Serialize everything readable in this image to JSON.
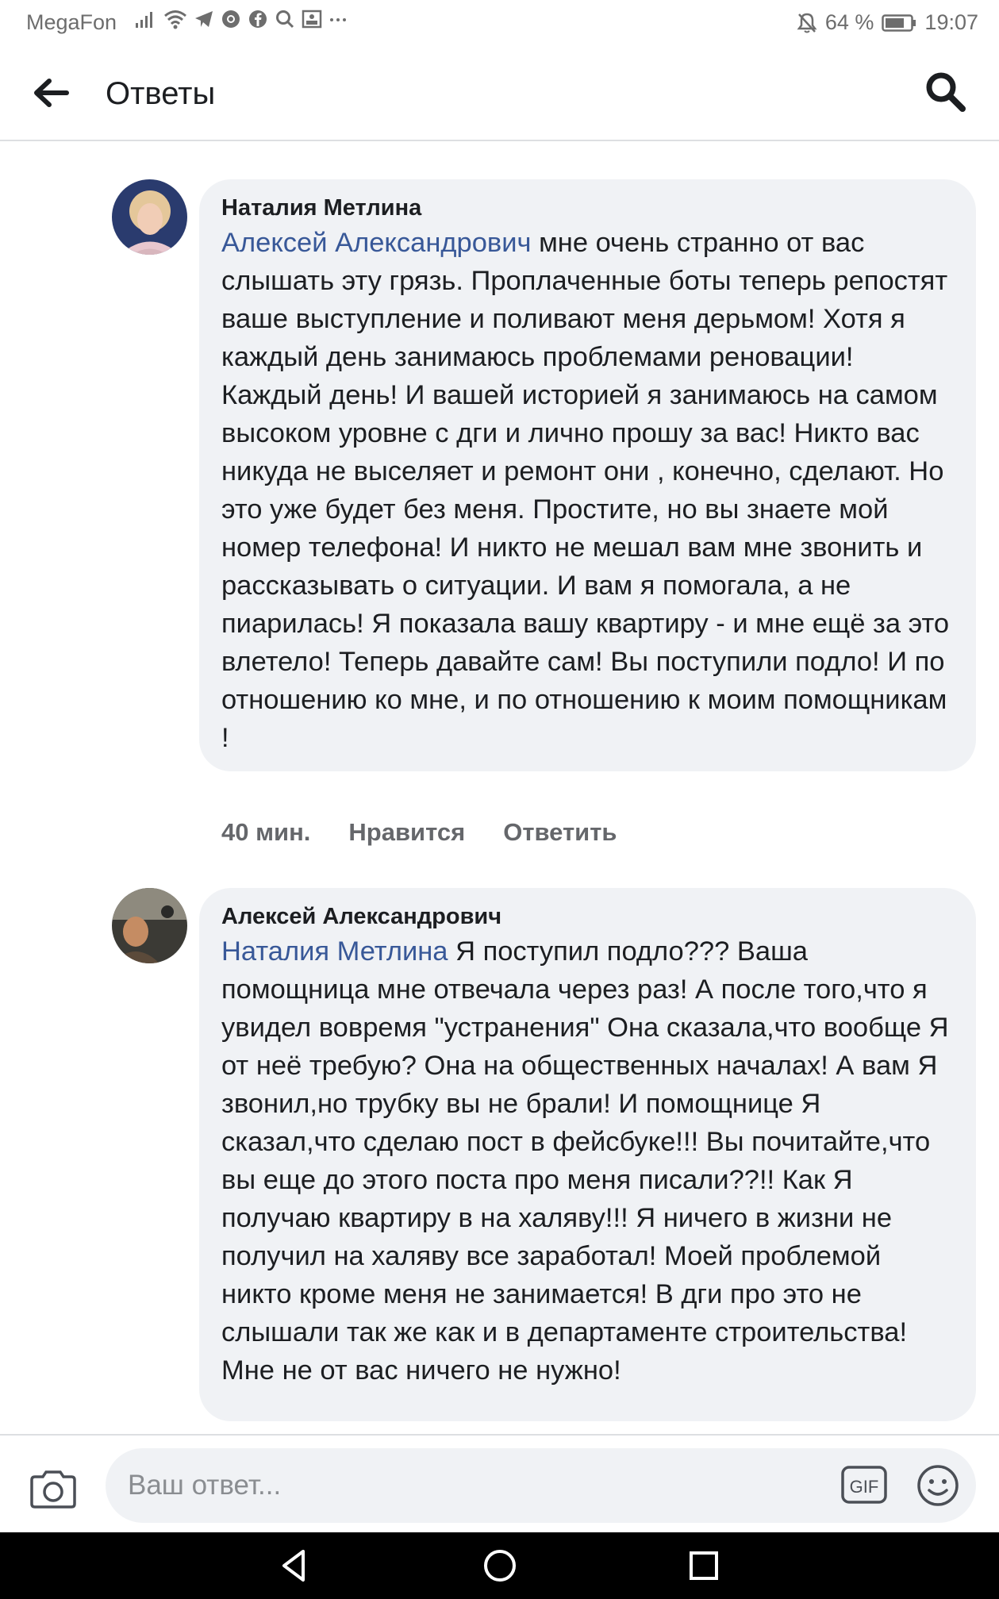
{
  "status_bar": {
    "carrier": "MegaFon",
    "battery": "64 %",
    "time": "19:07",
    "icons": [
      "signal-icon",
      "wifi-icon",
      "telegram-icon",
      "chrome-icon",
      "facebook-icon",
      "search-icon",
      "gallery-icon",
      "more-icon",
      "mute-icon",
      "battery-icon"
    ]
  },
  "header": {
    "title": "Ответы",
    "back_icon": "arrow-left-icon",
    "search_icon": "search-icon"
  },
  "comments": [
    {
      "author": "Наталия Метлина",
      "mention": "Алексей Александрович",
      "text": "мне очень странно от вас слышать эту грязь. Проплаченные боты теперь репостят ваше выступление и поливают меня дерьмом! Хотя я каждый день занимаюсь проблемами реновации! Каждый день! И вашей историей я занимаюсь на самом высоком уровне с дги и лично прошу за вас! Никто вас никуда не выселяет и ремонт они , конечно, сделают. Но это уже будет без меня. Простите, но вы знаете мой номер телефона! И никто не мешал вам мне звонить и рассказывать о ситуации. И вам я помогала, а не пиарилась! Я показала вашу квартиру - и мне ещё за это влетело! Теперь давайте сам! Вы поступили подло! И по отношению ко мне, и по отношению к моим помощникам !",
      "time": "40 мин.",
      "like_label": "Нравится",
      "reply_label": "Ответить"
    },
    {
      "author": "Алексей Александрович",
      "mention": "Наталия Метлина",
      "text": "Я поступил подло??? Ваша помощница мне отвечала через раз! А после того,что я увидел вовремя \"устранения\" Она сказала,что вообще Я от неё требую? Она на общественных началах! А вам Я звонил,но трубку вы не брали! И помощнице Я сказал,что сделаю пост в фейсбуке!!! Вы почитайте,что вы еще до этого поста про меня писали??!! Как Я получаю квартиру в на халяву!!! Я ничего в жизни не получил на халяву все заработал! Моей проблемой никто кроме меня не занимается! В дги про это не слышали так же как и в департаменте строительства!Мне не от вас ничего не нужно!"
    }
  ],
  "composer": {
    "placeholder": "Ваш ответ...",
    "gif_label": "GIF",
    "camera_icon": "camera-icon",
    "emoji_icon": "emoji-icon"
  },
  "nav": {
    "back_icon": "triangle-back-icon",
    "home_icon": "circle-home-icon",
    "recents_icon": "square-recents-icon"
  },
  "colors": {
    "mention": "#385898",
    "bubble": "#f0f2f5",
    "secondary_text": "#65676b"
  }
}
